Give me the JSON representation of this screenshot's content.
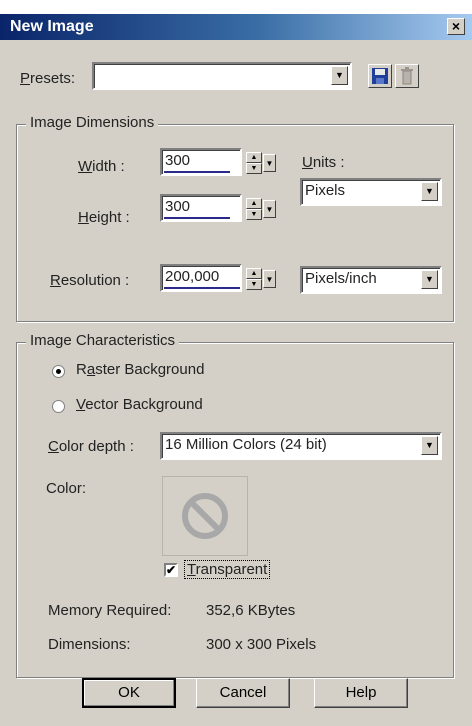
{
  "window": {
    "title": "New Image",
    "close_glyph": "×"
  },
  "presets": {
    "label_key": "P",
    "label_rest": "resets:",
    "value": ""
  },
  "dimensions": {
    "group_title": "Image Dimensions",
    "width": {
      "label_key": "W",
      "label_rest": "idth :",
      "value": "300"
    },
    "height": {
      "label_key": "H",
      "label_rest": "eight :",
      "value": "300"
    },
    "resolution": {
      "label_key": "R",
      "label_rest": "esolution :",
      "value": "200,000"
    },
    "units": {
      "label_key": "U",
      "label_rest": "nits :",
      "value": "Pixels"
    },
    "resolution_units": {
      "value": "Pixels/inch"
    }
  },
  "characteristics": {
    "group_title": "Image Characteristics",
    "raster": {
      "pre": "R",
      "key": "a",
      "rest": "ster Background",
      "selected": true
    },
    "vector": {
      "pre": "",
      "key": "V",
      "rest": "ector Background",
      "selected": false
    },
    "color_depth": {
      "label_key": "C",
      "label_rest": "olor depth :",
      "value": "16 Million Colors (24 bit)"
    },
    "color_label": "Color:",
    "transparent": {
      "key": "T",
      "rest": "ransparent",
      "checked": true,
      "check_glyph": "✔"
    },
    "memory": {
      "label": "Memory Required:",
      "value": "352,6 KBytes"
    },
    "dims": {
      "label": "Dimensions:",
      "value": "300 x 300 Pixels"
    }
  },
  "buttons": {
    "ok": "OK",
    "cancel": "Cancel",
    "help": "Help"
  },
  "colors": {
    "titlebar_start": "#0a246a",
    "titlebar_end": "#a6caf0",
    "face": "#d4d0c8",
    "swatch_icon": "#a8a8a8"
  }
}
